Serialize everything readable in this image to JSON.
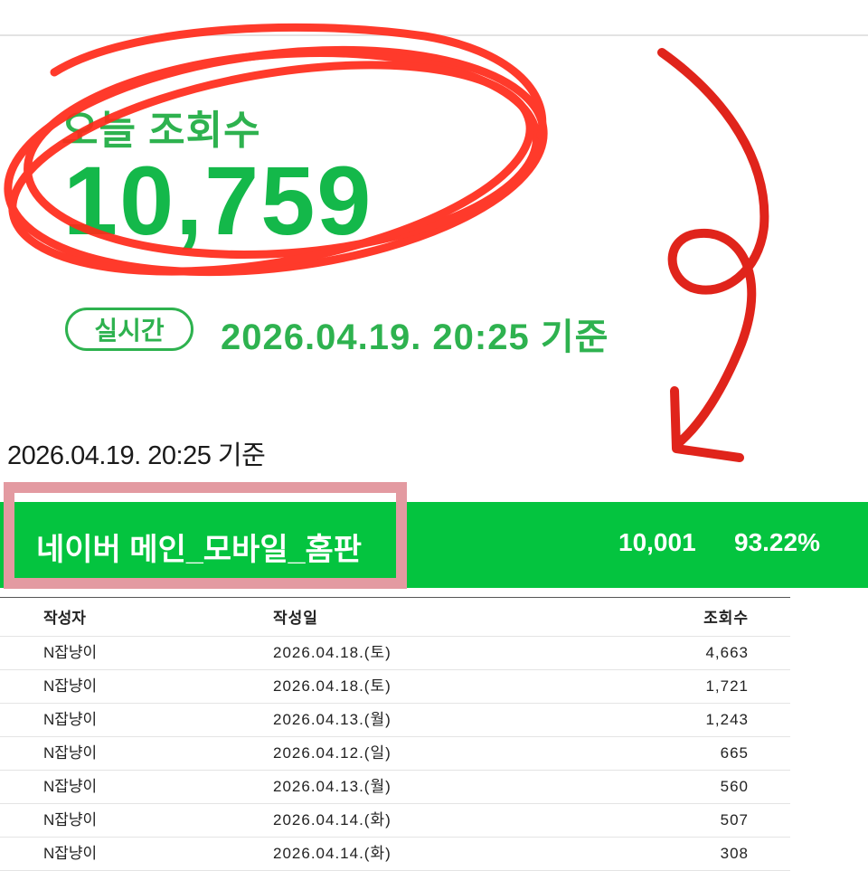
{
  "today": {
    "label": "오늘 조회수",
    "count": "10,759",
    "badge": "실시간",
    "timestamp": "2026.04.19. 20:25 기준"
  },
  "basis_time": "2026.04.19. 20:25 기준",
  "source": {
    "name": "네이버 메인_모바일_홈판",
    "views": "10,001",
    "percent": "93.22%"
  },
  "annotation_colors": {
    "circle": "#ff2a1a",
    "arrow": "#e0241b",
    "highlight_box": "#e39aa1",
    "bar": "#04c43f"
  },
  "table": {
    "headers": {
      "author": "작성자",
      "date": "작성일",
      "views": "조회수"
    },
    "rows": [
      {
        "author": "N잡냥이",
        "date": "2026.04.18.(토)",
        "views": "4,663"
      },
      {
        "author": "N잡냥이",
        "date": "2026.04.18.(토)",
        "views": "1,721"
      },
      {
        "author": "N잡냥이",
        "date": "2026.04.13.(월)",
        "views": "1,243"
      },
      {
        "author": "N잡냥이",
        "date": "2026.04.12.(일)",
        "views": "665"
      },
      {
        "author": "N잡냥이",
        "date": "2026.04.13.(월)",
        "views": "560"
      },
      {
        "author": "N잡냥이",
        "date": "2026.04.14.(화)",
        "views": "507"
      },
      {
        "author": "N잡냥이",
        "date": "2026.04.14.(화)",
        "views": "308"
      }
    ]
  }
}
